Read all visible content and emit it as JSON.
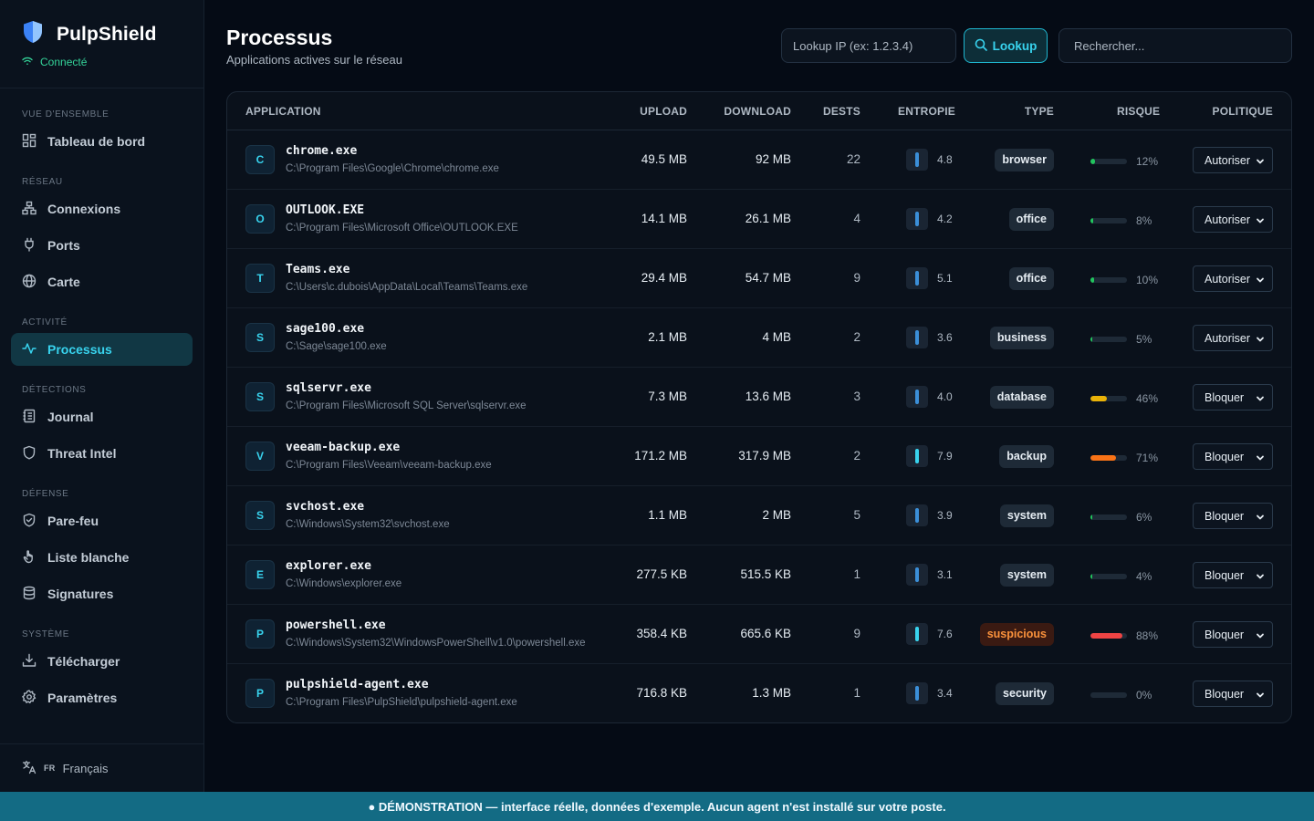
{
  "brand": {
    "name": "PulpShield",
    "status": "Connecté"
  },
  "nav": {
    "sections": [
      {
        "label": "VUE D'ENSEMBLE",
        "items": [
          {
            "label": "Tableau de bord",
            "icon": "dashboard-icon"
          }
        ]
      },
      {
        "label": "RÉSEAU",
        "items": [
          {
            "label": "Connexions",
            "icon": "network-icon"
          },
          {
            "label": "Ports",
            "icon": "plug-icon"
          },
          {
            "label": "Carte",
            "icon": "globe-icon"
          }
        ]
      },
      {
        "label": "ACTIVITÉ",
        "items": [
          {
            "label": "Processus",
            "icon": "activity-icon",
            "active": true
          }
        ]
      },
      {
        "label": "DÉTECTIONS",
        "items": [
          {
            "label": "Journal",
            "icon": "journal-icon"
          },
          {
            "label": "Threat Intel",
            "icon": "shield-icon"
          }
        ]
      },
      {
        "label": "DÉFENSE",
        "items": [
          {
            "label": "Pare-feu",
            "icon": "shield-check-icon"
          },
          {
            "label": "Liste blanche",
            "icon": "hand-icon"
          },
          {
            "label": "Signatures",
            "icon": "database-icon"
          }
        ]
      },
      {
        "label": "SYSTÈME",
        "items": [
          {
            "label": "Télécharger",
            "icon": "download-icon"
          },
          {
            "label": "Paramètres",
            "icon": "gear-icon"
          }
        ]
      }
    ]
  },
  "language": {
    "code": "FR",
    "label": "Français"
  },
  "header": {
    "title": "Processus",
    "subtitle": "Applications actives sur le réseau"
  },
  "toolbar": {
    "lookup_placeholder": "Lookup IP (ex: 1.2.3.4)",
    "lookup_label": "Lookup",
    "search_placeholder": "Rechercher..."
  },
  "table": {
    "columns": [
      "APPLICATION",
      "UPLOAD",
      "DOWNLOAD",
      "DESTS",
      "ENTROPIE",
      "TYPE",
      "RISQUE",
      "POLITIQUE"
    ],
    "rows": [
      {
        "initial": "C",
        "name": "chrome.exe",
        "path": "C:\\Program Files\\Google\\Chrome\\chrome.exe",
        "upload": "49.5 MB",
        "download": "92 MB",
        "dests": "22",
        "entropy": "4.8",
        "type": "browser",
        "risk": "12%",
        "risk_value": 12,
        "risk_color": "#22c55e",
        "policy": "Autoriser"
      },
      {
        "initial": "O",
        "name": "OUTLOOK.EXE",
        "path": "C:\\Program Files\\Microsoft Office\\OUTLOOK.EXE",
        "upload": "14.1 MB",
        "download": "26.1 MB",
        "dests": "4",
        "entropy": "4.2",
        "type": "office",
        "risk": "8%",
        "risk_value": 8,
        "risk_color": "#22c55e",
        "policy": "Autoriser"
      },
      {
        "initial": "T",
        "name": "Teams.exe",
        "path": "C:\\Users\\c.dubois\\AppData\\Local\\Teams\\Teams.exe",
        "upload": "29.4 MB",
        "download": "54.7 MB",
        "dests": "9",
        "entropy": "5.1",
        "type": "office",
        "risk": "10%",
        "risk_value": 10,
        "risk_color": "#22c55e",
        "policy": "Autoriser"
      },
      {
        "initial": "S",
        "name": "sage100.exe",
        "path": "C:\\Sage\\sage100.exe",
        "upload": "2.1 MB",
        "download": "4 MB",
        "dests": "2",
        "entropy": "3.6",
        "type": "business",
        "risk": "5%",
        "risk_value": 5,
        "risk_color": "#22c55e",
        "policy": "Autoriser"
      },
      {
        "initial": "S",
        "name": "sqlservr.exe",
        "path": "C:\\Program Files\\Microsoft SQL Server\\sqlservr.exe",
        "upload": "7.3 MB",
        "download": "13.6 MB",
        "dests": "3",
        "entropy": "4.0",
        "type": "database",
        "risk": "46%",
        "risk_value": 46,
        "risk_color": "#eab308",
        "policy": "Bloquer"
      },
      {
        "initial": "V",
        "name": "veeam-backup.exe",
        "path": "C:\\Program Files\\Veeam\\veeam-backup.exe",
        "upload": "171.2 MB",
        "download": "317.9 MB",
        "dests": "2",
        "entropy": "7.9",
        "type": "backup",
        "risk": "71%",
        "risk_value": 71,
        "risk_color": "#f97316",
        "policy": "Bloquer"
      },
      {
        "initial": "S",
        "name": "svchost.exe",
        "path": "C:\\Windows\\System32\\svchost.exe",
        "upload": "1.1 MB",
        "download": "2 MB",
        "dests": "5",
        "entropy": "3.9",
        "type": "system",
        "risk": "6%",
        "risk_value": 6,
        "risk_color": "#22c55e",
        "policy": "Bloquer"
      },
      {
        "initial": "E",
        "name": "explorer.exe",
        "path": "C:\\Windows\\explorer.exe",
        "upload": "277.5 KB",
        "download": "515.5 KB",
        "dests": "1",
        "entropy": "3.1",
        "type": "system",
        "risk": "4%",
        "risk_value": 4,
        "risk_color": "#22c55e",
        "policy": "Bloquer"
      },
      {
        "initial": "P",
        "name": "powershell.exe",
        "path": "C:\\Windows\\System32\\WindowsPowerShell\\v1.0\\powershell.exe",
        "upload": "358.4 KB",
        "download": "665.6 KB",
        "dests": "9",
        "entropy": "7.6",
        "type": "suspicious",
        "risk": "88%",
        "risk_value": 88,
        "risk_color": "#ef4444",
        "policy": "Bloquer"
      },
      {
        "initial": "P",
        "name": "pulpshield-agent.exe",
        "path": "C:\\Program Files\\PulpShield\\pulpshield-agent.exe",
        "upload": "716.8 KB",
        "download": "1.3 MB",
        "dests": "1",
        "entropy": "3.4",
        "type": "security",
        "risk": "0%",
        "risk_value": 0,
        "risk_color": "#22c55e",
        "policy": "Bloquer"
      }
    ]
  },
  "banner": {
    "text": "● DÉMONSTRATION — interface réelle, données d'exemple. Aucun agent n'est installé sur votre poste."
  },
  "colors": {
    "accent": "#38d3ee",
    "connected": "#34d399",
    "banner": "#136b84",
    "suspicious": "#fb923c"
  }
}
